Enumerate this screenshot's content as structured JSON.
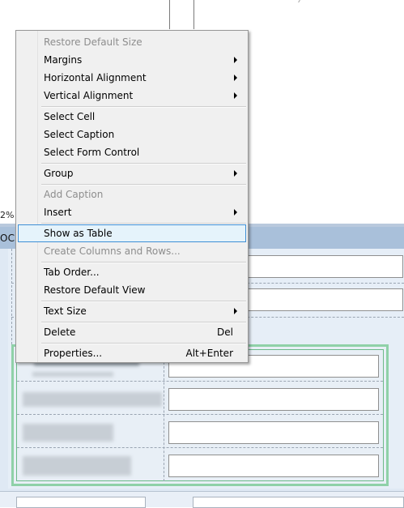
{
  "background": {
    "zoom_partial": "2%",
    "header_partial": "OCU"
  },
  "context_menu": {
    "items": [
      {
        "label": "Restore Default Size",
        "disabled": true
      },
      {
        "label": "Margins",
        "submenu": true
      },
      {
        "label": "Horizontal Alignment",
        "submenu": true
      },
      {
        "label": "Vertical Alignment",
        "submenu": true
      },
      {
        "label": "Select Cell"
      },
      {
        "label": "Select Caption"
      },
      {
        "label": "Select Form Control"
      },
      {
        "label": "Group",
        "submenu": true
      },
      {
        "label": "Add Caption",
        "disabled": true
      },
      {
        "label": "Insert",
        "submenu": true
      },
      {
        "label": "Show as Table",
        "highlighted": true
      },
      {
        "label": "Create Columns and Rows...",
        "disabled": true
      },
      {
        "label": "Tab Order..."
      },
      {
        "label": "Restore Default View"
      },
      {
        "label": "Text Size",
        "submenu": true
      },
      {
        "label": "Delete",
        "shortcut": "Del"
      },
      {
        "label": "Properties...",
        "shortcut": "Alt+Enter"
      }
    ]
  },
  "colors": {
    "menu_background": "#f0f0f0",
    "highlight_background": "#e5f3fb",
    "highlight_border": "#3e8fd5",
    "header_bar": "#a9c0da",
    "form_background": "#dfe9f4",
    "group_frame": "#8fd1a8"
  }
}
